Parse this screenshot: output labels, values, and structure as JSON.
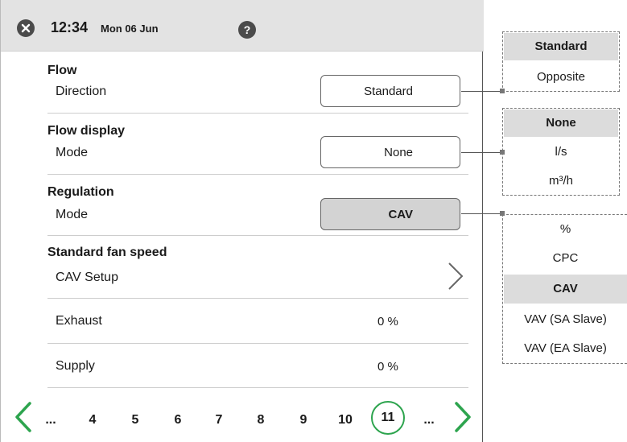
{
  "header": {
    "time": "12:34",
    "date": "Mon 06 Jun",
    "help_label": "?"
  },
  "sections": {
    "flow": {
      "title": "Flow",
      "row_label": "Direction",
      "selected": "Standard"
    },
    "flow_display": {
      "title": "Flow display",
      "row_label": "Mode",
      "selected": "None"
    },
    "regulation": {
      "title": "Regulation",
      "row_label": "Mode",
      "selected": "CAV"
    },
    "fan_speed": {
      "title": "Standard fan speed",
      "row_label": "CAV Setup",
      "exhaust_label": "Exhaust",
      "exhaust_value": "0 %",
      "supply_label": "Supply",
      "supply_value": "0 %"
    }
  },
  "pagination": {
    "ellipsis_left": "...",
    "pages": [
      "4",
      "5",
      "6",
      "7",
      "8",
      "9",
      "10"
    ],
    "current": "11",
    "ellipsis_right": "..."
  },
  "option_lists": {
    "flow_direction": [
      "Standard",
      "Opposite"
    ],
    "flow_display_mode": [
      "None",
      "l/s",
      "m³/h"
    ],
    "regulation_mode": [
      "%",
      "CPC",
      "CAV",
      "VAV (SA Slave)",
      "VAV (EA Slave)"
    ]
  },
  "colors": {
    "accent_green": "#2da44e",
    "header_bg": "#e3e3e3",
    "selected_bg": "#dcdcdc"
  },
  "icons": {
    "close": "close-icon",
    "help": "help-icon",
    "nav_prev": "chevron-left-icon",
    "nav_next": "chevron-right-icon",
    "row_open": "chevron-right-icon",
    "dropdown": "caret-down-icon"
  }
}
